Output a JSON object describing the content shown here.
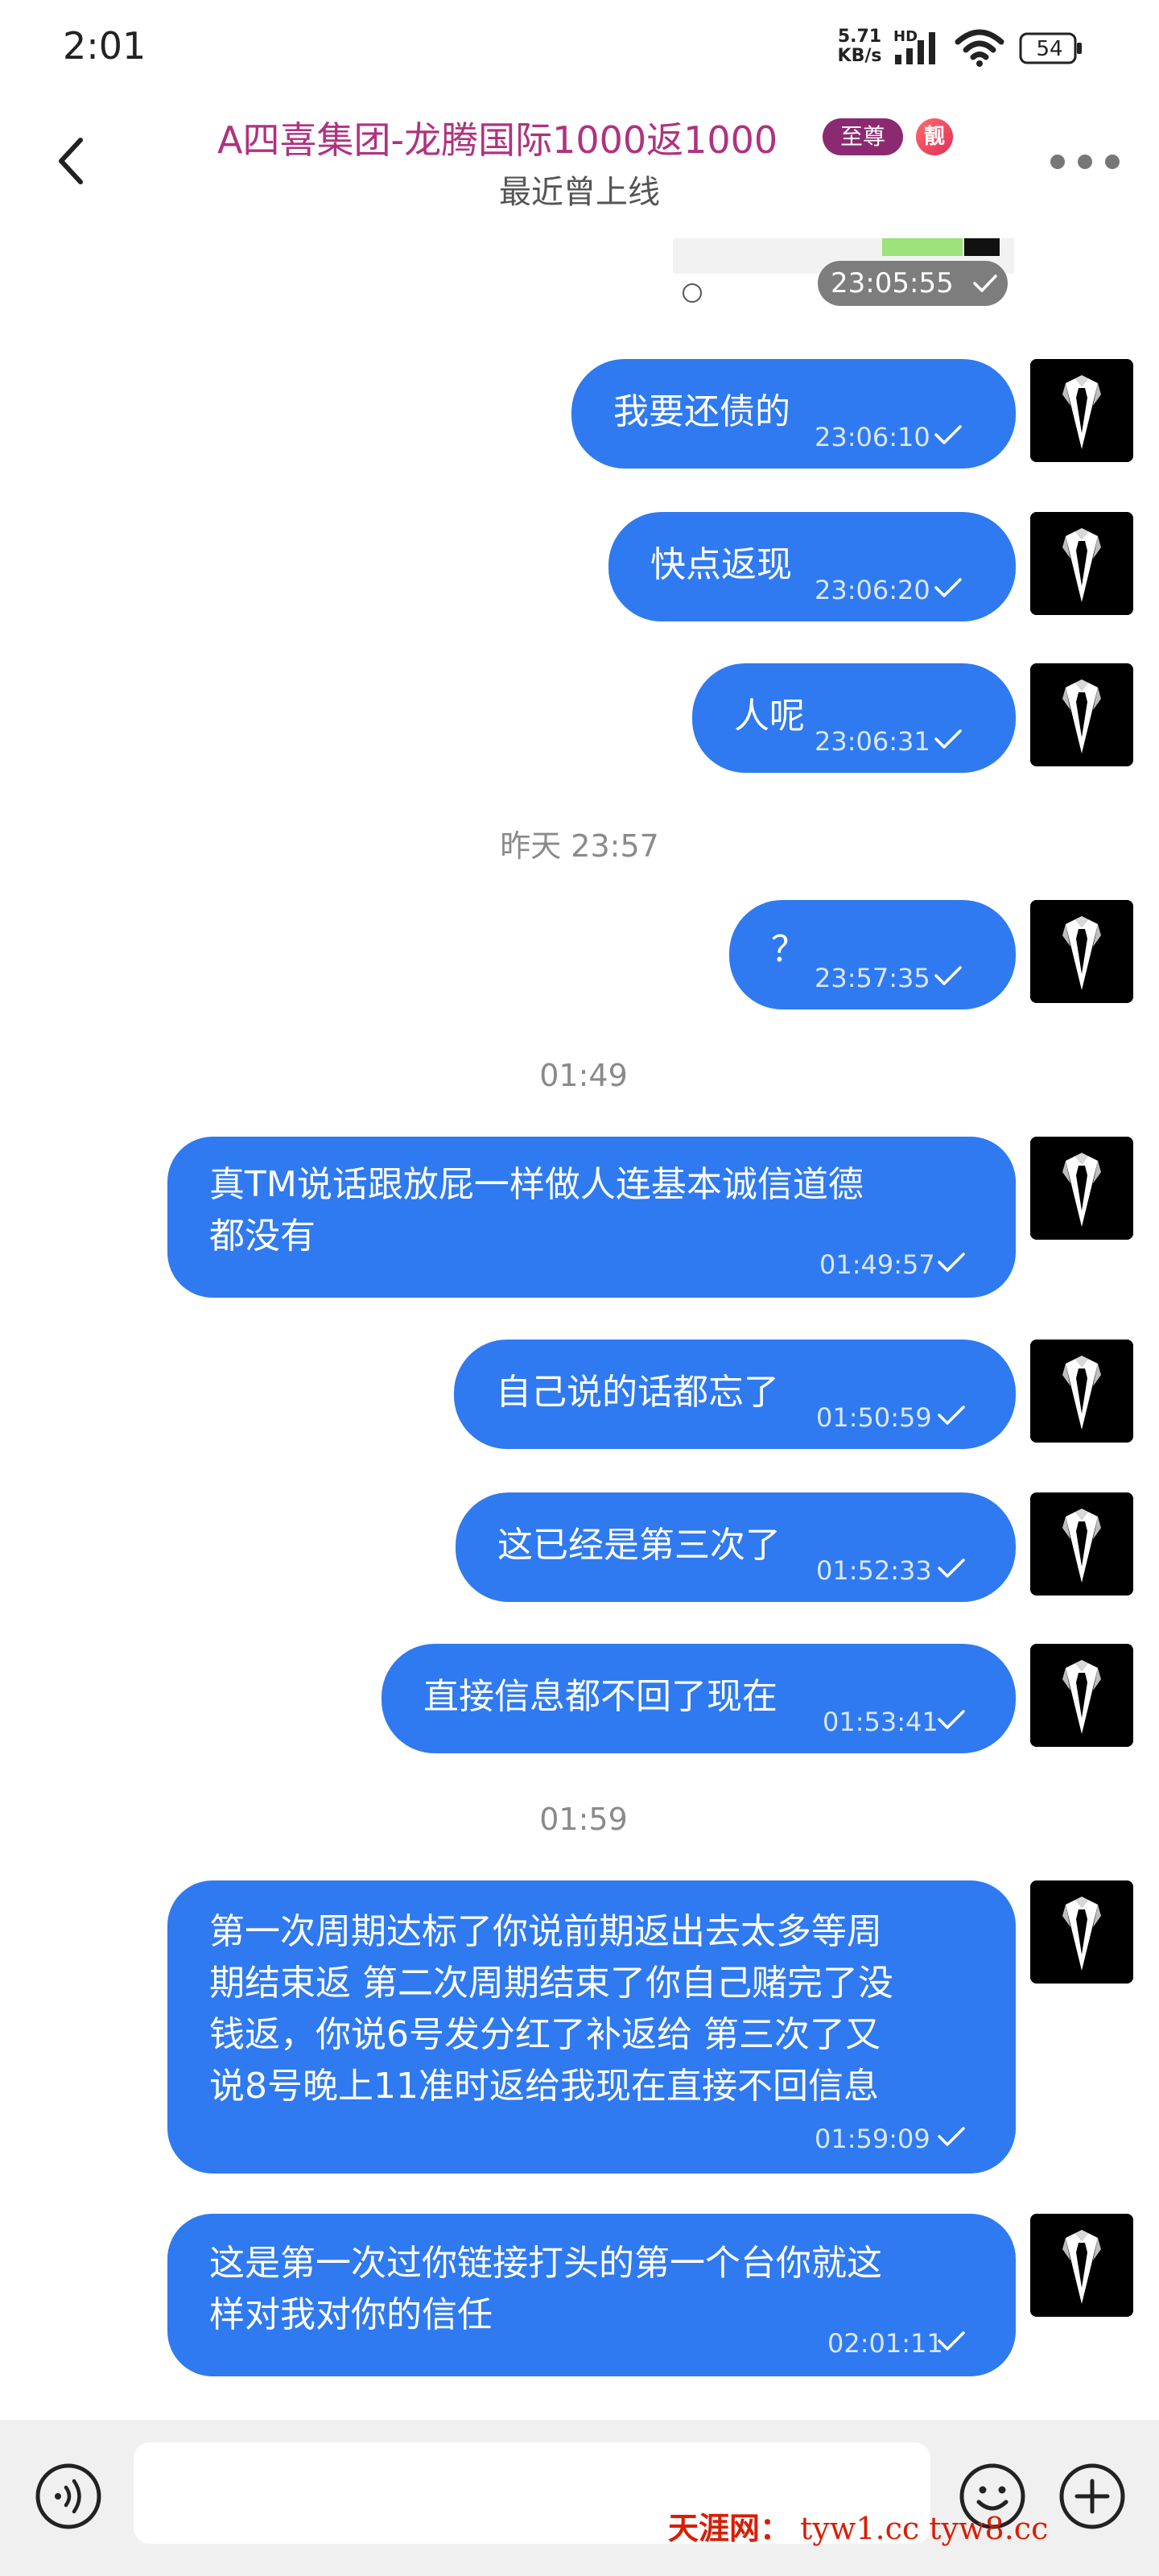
{
  "status_bar": {
    "time": "2:01",
    "net_speed": "5.71",
    "net_unit": "KB/s",
    "hd": "HD",
    "battery": "54"
  },
  "header": {
    "contact_name": "A四喜集团-龙腾国际1000返1000",
    "vip_badge": "至尊",
    "pretty_badge": "靓",
    "status": "最近曾上线"
  },
  "image_message": {
    "time": "23:05:55"
  },
  "messages": [
    {
      "text": "我要还债的",
      "time": "23:06:10"
    },
    {
      "text": "快点返现",
      "time": "23:06:20"
    },
    {
      "text": "人呢",
      "time": "23:06:31"
    },
    {
      "text": "？",
      "time": "23:57:35"
    },
    {
      "lines": [
        "真TM说话跟放屁一样做人连基本诚信道德",
        "都没有"
      ],
      "time": "01:49:57"
    },
    {
      "text": "自己说的话都忘了",
      "time": "01:50:59"
    },
    {
      "text": "这已经是第三次了",
      "time": "01:52:33"
    },
    {
      "text": "直接信息都不回了现在",
      "time": "01:53:41"
    },
    {
      "lines": [
        "第一次周期达标了你说前期返出去太多等周",
        "期结束返 第二次周期结束了你自己赌完了没",
        "钱返，你说6号发分红了补返给 第三次了又",
        "说8号晚上11准时返给我现在直接不回信息"
      ],
      "time": "01:59:09"
    },
    {
      "lines": [
        "这是第一次过你链接打头的第一个台你就这",
        "样对我对你的信任"
      ],
      "time": "02:01:11"
    }
  ],
  "separators": {
    "yesterday": "昨天 23:57",
    "s0149": "01:49",
    "s0159": "01:59"
  },
  "watermark": {
    "cn": "天涯网：",
    "url": "tyw1.cc  tyw8.cc"
  }
}
